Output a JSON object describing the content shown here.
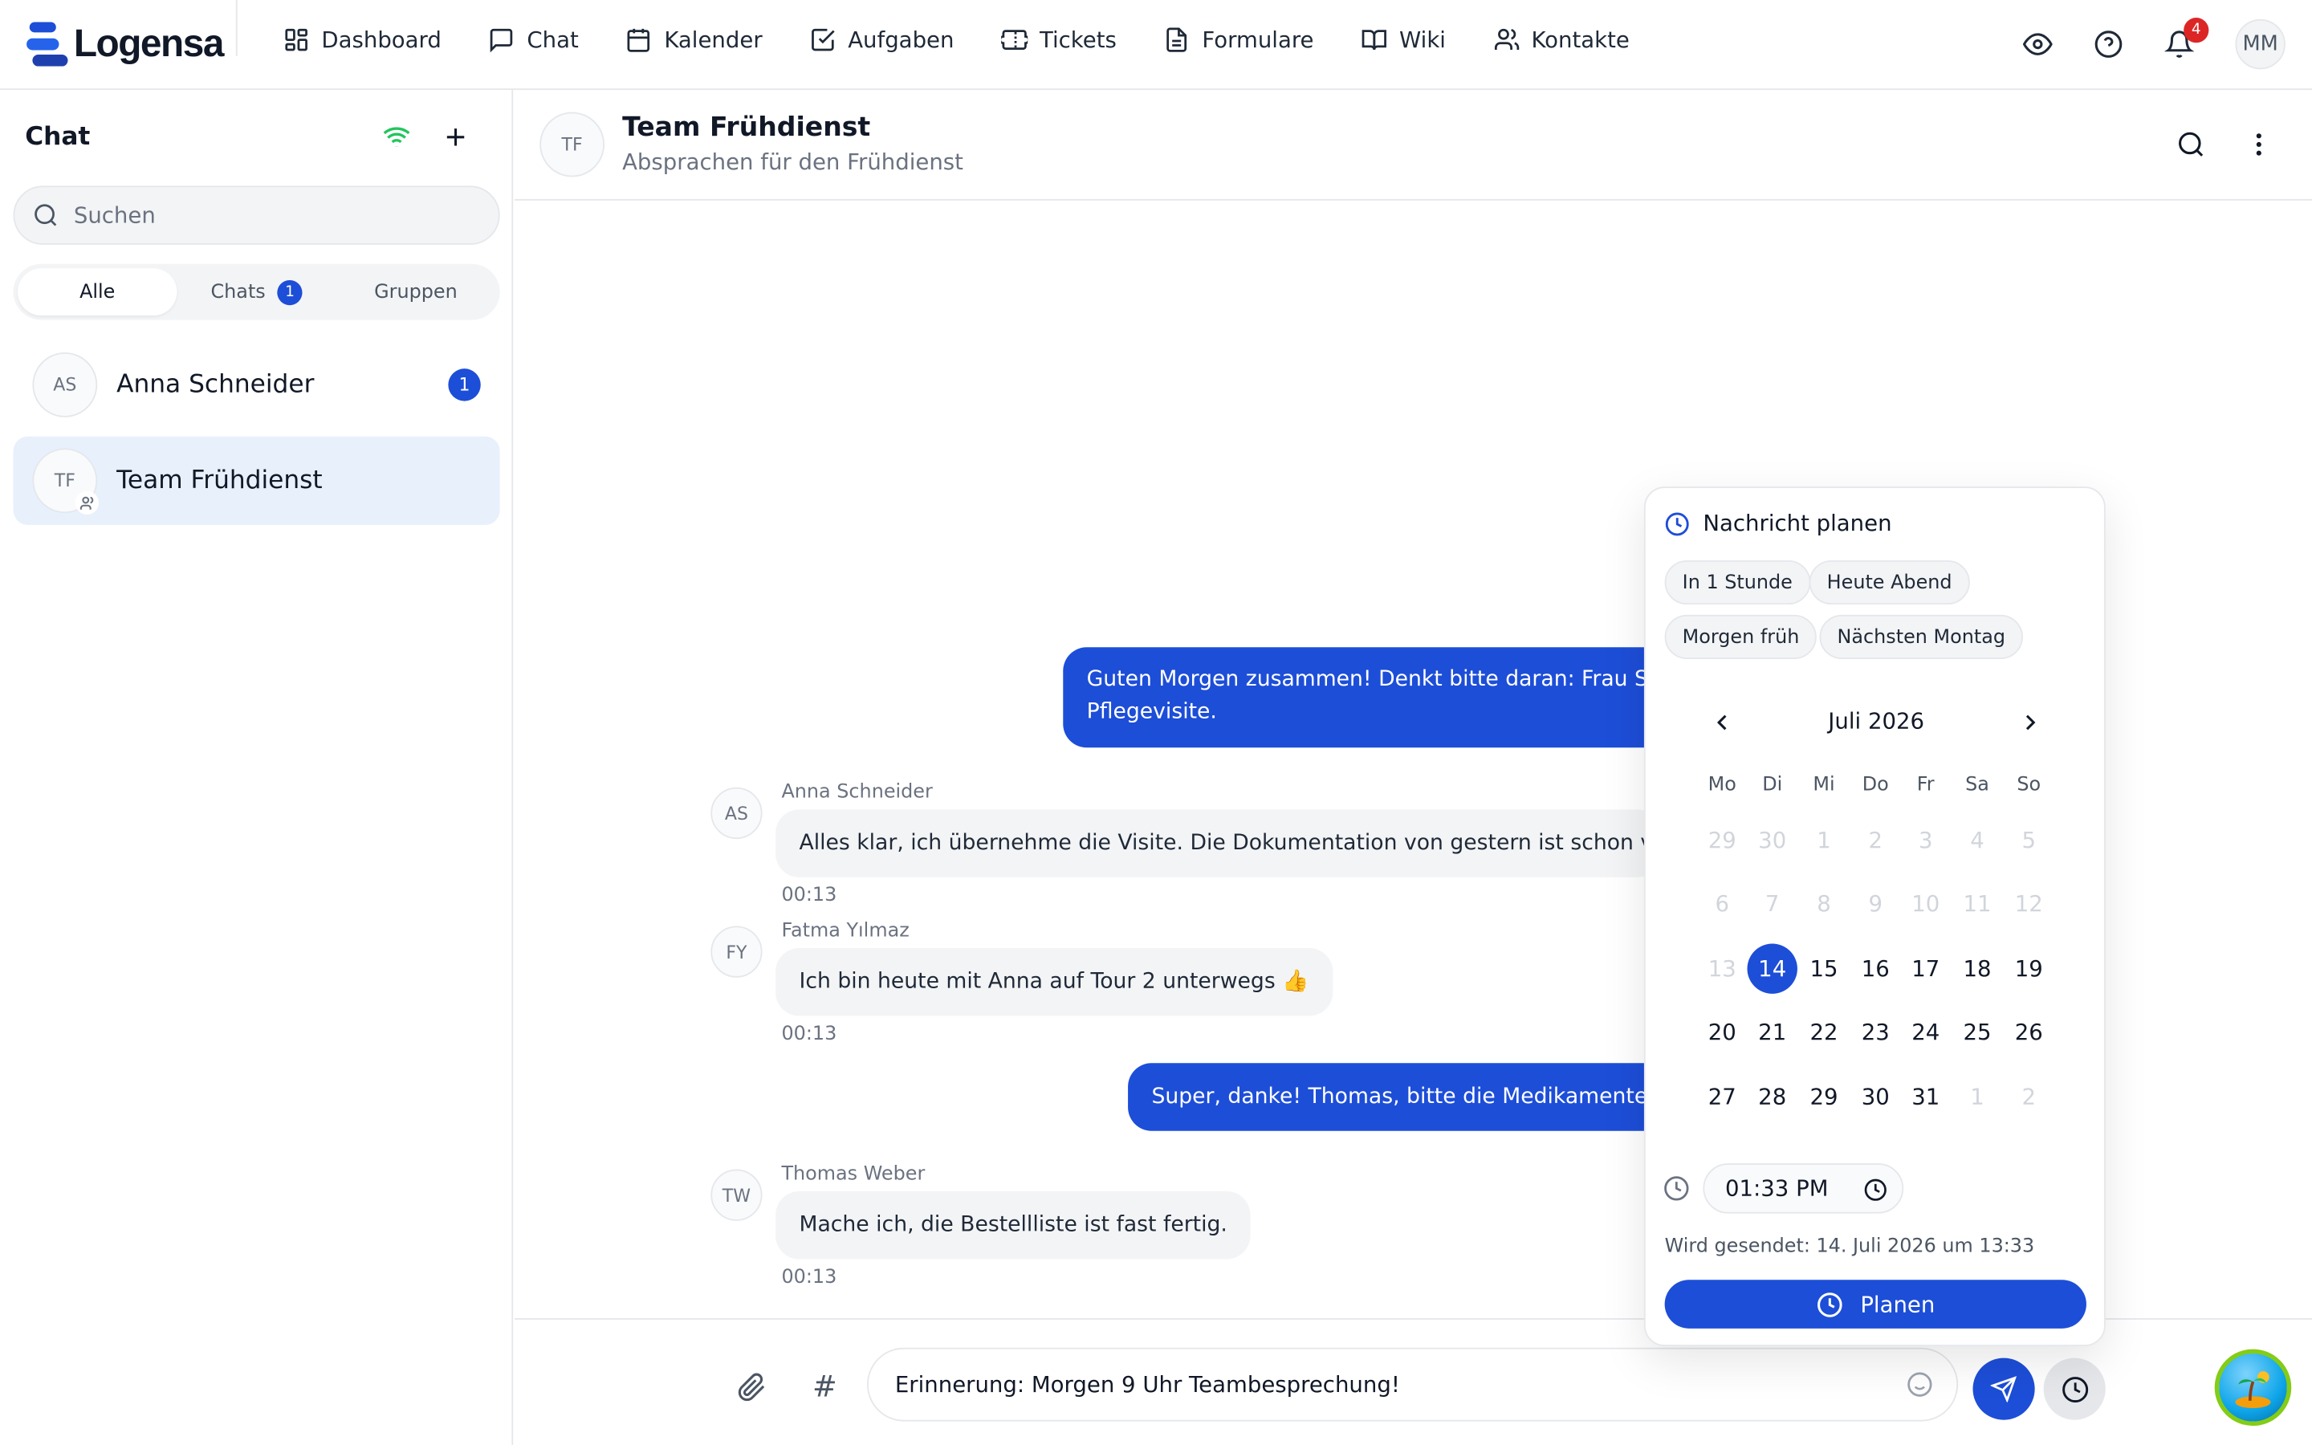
{
  "brand": {
    "name": "Logensa"
  },
  "nav": [
    "Dashboard",
    "Chat",
    "Kalender",
    "Aufgaben",
    "Tickets",
    "Formulare",
    "Wiki",
    "Kontakte"
  ],
  "topbar": {
    "notifications_count": "4",
    "user_initials": "MM"
  },
  "sidebar": {
    "title": "Chat",
    "search_placeholder": "Suchen",
    "tabs": {
      "all": "Alle",
      "chats": "Chats",
      "chats_badge": "1",
      "groups": "Gruppen"
    },
    "chats": [
      {
        "initials": "AS",
        "name": "Anna Schneider",
        "unread": "1"
      },
      {
        "initials": "TF",
        "name": "Team Frühdienst"
      }
    ]
  },
  "conversation": {
    "initials": "TF",
    "title": "Team Frühdienst",
    "subtitle": "Absprachen für den Frühdienst"
  },
  "messages": {
    "out1": {
      "line1": "Guten Morgen zusammen! Denkt bitte daran: Frau Sch",
      "line2": "Pflegevisite."
    },
    "in1": {
      "initials": "AS",
      "sender": "Anna Schneider",
      "text": "Alles klar, ich übernehme die Visite. Die Dokumentation von gestern ist schon vollst",
      "time": "00:13"
    },
    "in2": {
      "initials": "FY",
      "sender": "Fatma Yılmaz",
      "text": "Ich bin heute mit Anna auf Tour 2 unterwegs 👍",
      "time": "00:13"
    },
    "out2": {
      "text": "Super, danke! Thomas, bitte die Medikamentenb"
    },
    "in3": {
      "initials": "TW",
      "sender": "Thomas Weber",
      "text": "Mache ich, die Bestellliste ist fast fertig.",
      "time": "00:13"
    }
  },
  "composer": {
    "hash_symbol": "#",
    "text": "Erinnerung: Morgen 9 Uhr Teambesprechung!"
  },
  "scheduler": {
    "title": "Nachricht planen",
    "presets": [
      "In 1 Stunde",
      "Heute Abend",
      "Morgen früh",
      "Nächsten Montag"
    ],
    "month": "Juli 2026",
    "weekdays": [
      "Mo",
      "Di",
      "Mi",
      "Do",
      "Fr",
      "Sa",
      "So"
    ],
    "weeks": [
      [
        "29",
        "30",
        "1",
        "2",
        "3",
        "4",
        "5"
      ],
      [
        "6",
        "7",
        "8",
        "9",
        "10",
        "11",
        "12"
      ],
      [
        "13",
        "14",
        "15",
        "16",
        "17",
        "18",
        "19"
      ],
      [
        "20",
        "21",
        "22",
        "23",
        "24",
        "25",
        "26"
      ],
      [
        "27",
        "28",
        "29",
        "30",
        "31",
        "1",
        "2"
      ]
    ],
    "selected_day": "14",
    "time": "01:33 PM",
    "sends_at": "Wird gesendet: 14. Juli 2026 um 13:33",
    "plan_label": "Planen"
  },
  "colors": {
    "accent": "#1d4ed8",
    "wifi": "#22c55e",
    "badge_red": "#dc2626"
  }
}
